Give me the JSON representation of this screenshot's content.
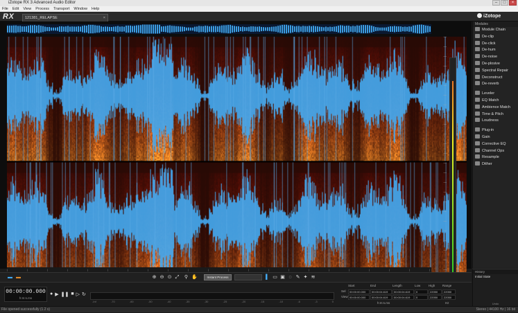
{
  "window": {
    "title": "iZotope RX 3 Advanced Audio Editor"
  },
  "menu": [
    "File",
    "Edit",
    "View",
    "Process",
    "Transport",
    "Window",
    "Help"
  ],
  "app": {
    "logo": "RX",
    "file_tab": "121381_RELAPSE",
    "brand": "iZotope"
  },
  "modules": {
    "header": "Modules",
    "items": [
      "Module Chain",
      "De-clip",
      "De-click",
      "De-hum",
      "De-noise",
      "De-plosive",
      "Spectral Repair",
      "Deconstruct",
      "De-reverb",
      "Leveler",
      "EQ Match",
      "Ambience Match",
      "Time & Pitch",
      "Loudness",
      "Plug-in",
      "Gain",
      "Corrective EQ",
      "Channel Ops",
      "Resample",
      "Dither"
    ]
  },
  "history": {
    "header": "History",
    "items": [
      "Initial State"
    ],
    "label": "Undo"
  },
  "toolbar": {
    "instant_process": "Instant Process"
  },
  "transport": {
    "timecode": "00:00:00.000",
    "unit": "h:m:s.ms"
  },
  "level_scale": [
    "-Inf",
    "-70",
    "-60",
    "-50",
    "-40",
    "-35",
    "-30",
    "-25",
    "-20",
    "-15",
    "-10",
    "-6",
    "-3",
    "0"
  ],
  "selection": {
    "headers": [
      "Start",
      "End",
      "Length",
      "Low",
      "High",
      "Range"
    ],
    "rows": [
      {
        "label": "Sel",
        "start": "00:00:00.000",
        "end": "00:00:04.619",
        "length": "00:00:04.619",
        "low": "0",
        "high": "22050",
        "range": "22050"
      },
      {
        "label": "View",
        "start": "00:00:00.000",
        "end": "00:00:04.619",
        "length": "00:00:04.619",
        "low": "0",
        "high": "22050",
        "range": "22050"
      }
    ],
    "format_label": "h:m:s.ms",
    "unit_label": "Hz"
  },
  "status": {
    "left": "File opened successfully (1.2 s)",
    "right": "Stereo | 44100 Hz | 16 bit"
  },
  "colors": {
    "waveform": "#43a8ef",
    "spectro_hot": "#f1a23a",
    "spectro_mid": "#b5561f",
    "background": "#0d0d0d"
  }
}
